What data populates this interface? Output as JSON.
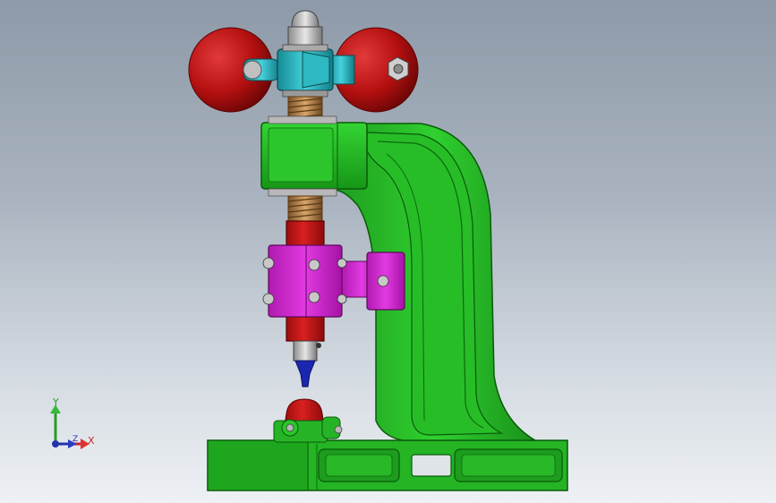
{
  "viewport": {
    "background_top": "#8e9aa8",
    "background_bottom": "#eef1f4"
  },
  "model": {
    "frame_color": "#23b323",
    "frame_dark_color": "#148a14",
    "handle_ball_color": "#c81414",
    "hub_color": "#2ab5c0",
    "clamp_color": "#cc22cc",
    "ram_color": "#c81818",
    "spring_color": "#b5824a",
    "punch_tip_color": "#1a28b0",
    "die_color": "#c81818"
  },
  "triad": {
    "y_label": "Y",
    "x_label": "X",
    "z_label": "Z",
    "y_color": "#2a9a2a",
    "x_color": "#cc2222",
    "z_color": "#2233aa"
  }
}
